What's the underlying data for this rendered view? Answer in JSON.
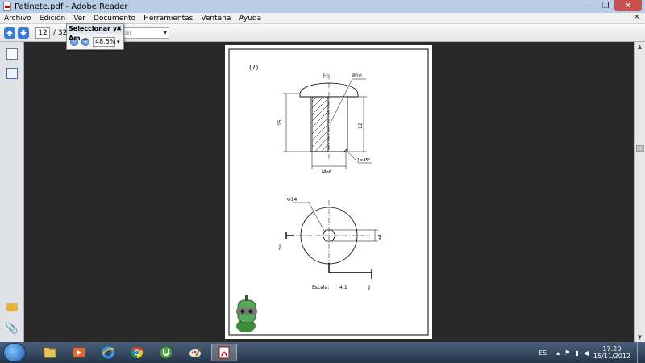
{
  "window": {
    "title": "Patinete.pdf - Adobe Reader",
    "minimize_glyph": "—",
    "maximize_glyph": "❐",
    "close_glyph": "✕"
  },
  "menubar": {
    "items": [
      "Archivo",
      "Edición",
      "Ver",
      "Documento",
      "Herramientas",
      "Ventana",
      "Ayuda"
    ],
    "close_glyph": "✕"
  },
  "toolbar": {
    "current_page": "12",
    "page_total": "/ 32",
    "search_placeholder": "car"
  },
  "zoom_panel": {
    "title": "Seleccionar y Am...",
    "close_glyph": "✖",
    "zoom_value": "48,5%"
  },
  "leftnav": {
    "icons": [
      "pages-icon",
      "bookmarks-icon",
      "comment-icon",
      "attachment-icon"
    ]
  },
  "drawing": {
    "number": "(7)",
    "section_label": "J-J",
    "radius_label": "R10",
    "height_15": "15",
    "height_12": "12",
    "thread_label": "M⌀8",
    "chamfer_label": "1×45°",
    "diam_14": "Φ14",
    "diam_4": "⌀4",
    "cut_j_left": "J",
    "cut_j_right": "J",
    "scale_label": "Escala:",
    "scale_value": "4:1"
  },
  "taskbar": {
    "apps": [
      "explorer",
      "media-player",
      "internet-explorer",
      "chrome",
      "utorrent",
      "paint",
      "adobe-reader"
    ],
    "active_app": "adobe-reader",
    "language": "ES",
    "time": "17:20",
    "date": "15/11/2012"
  },
  "colors": {
    "titlebar": "#b9cee6",
    "document_bg": "#292929",
    "accent_blue": "#3a7bd5",
    "taskbar": "#25364a"
  }
}
